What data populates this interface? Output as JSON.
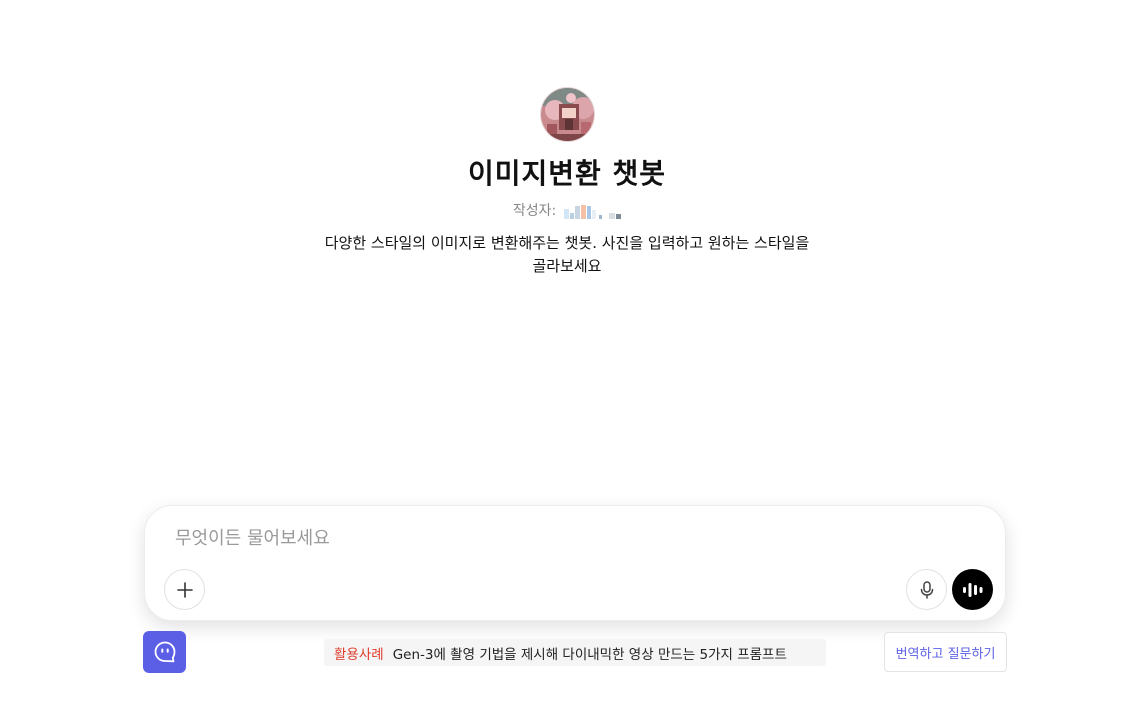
{
  "bot": {
    "title": "이미지변환 챗봇",
    "author_label": "작성자:",
    "description": "다양한 스타일의 이미지로 변환해주는 챗봇. 사진을 입력하고 원하는 스타일을 골라보세요"
  },
  "composer": {
    "placeholder": "무엇이든 물어보세요",
    "attach_icon": "plus-icon",
    "mic_icon": "microphone-icon",
    "voice_icon": "voice-wave-icon"
  },
  "footer": {
    "assistant_icon": "chat-face-icon",
    "tip_tag": "활용사례",
    "tip_text": "Gen-3에 촬영 기법을 제시해 다이내믹한 영상 만드는 5가지 프롬프트",
    "translate_label": "번역하고 질문하기"
  },
  "colors": {
    "accent": "#5b5fe6",
    "tip_tag": "#e03b2a",
    "voice_button": "#000000"
  }
}
